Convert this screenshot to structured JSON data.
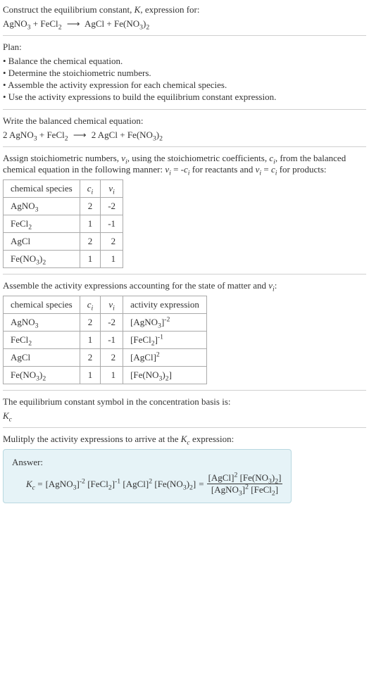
{
  "prompt": {
    "line1": "Construct the equilibrium constant, K, expression for:",
    "eq_lhs_1": "AgNO",
    "eq_lhs_1_sub": "3",
    "eq_plus1": " + ",
    "eq_lhs_2": "FeCl",
    "eq_lhs_2_sub": "2",
    "eq_arrow": "⟶",
    "eq_rhs_1": "AgCl",
    "eq_plus2": " + ",
    "eq_rhs_2": "Fe(NO",
    "eq_rhs_2_sub1": "3",
    "eq_rhs_2_mid": ")",
    "eq_rhs_2_sub2": "2"
  },
  "plan": {
    "title": "Plan:",
    "items": [
      "• Balance the chemical equation.",
      "• Determine the stoichiometric numbers.",
      "• Assemble the activity expression for each chemical species.",
      "• Use the activity expressions to build the equilibrium constant expression."
    ]
  },
  "balanced": {
    "title": "Write the balanced chemical equation:",
    "c1": "2 ",
    "s1": "AgNO",
    "s1sub": "3",
    "plus1": " + ",
    "s2": "FeCl",
    "s2sub": "2",
    "arrow": "⟶",
    "c3": "2 ",
    "s3": "AgCl",
    "plus2": " + ",
    "s4": "Fe(NO",
    "s4sub1": "3",
    "s4mid": ")",
    "s4sub2": "2"
  },
  "assign": {
    "text1": "Assign stoichiometric numbers, ",
    "nu": "ν",
    "nu_sub": "i",
    "text2": ", using the stoichiometric coefficients, ",
    "c": "c",
    "c_sub": "i",
    "text3": ", from the balanced chemical equation in the following manner: ",
    "eq1_l": "ν",
    "eq1_ls": "i",
    "eq1_m": " = -",
    "eq1_r": "c",
    "eq1_rs": "i",
    "text4": " for reactants and ",
    "eq2_l": "ν",
    "eq2_ls": "i",
    "eq2_m": " = ",
    "eq2_r": "c",
    "eq2_rs": "i",
    "text5": " for products:"
  },
  "table1": {
    "h1": "chemical species",
    "h2_a": "c",
    "h2_b": "i",
    "h3_a": "ν",
    "h3_b": "i",
    "rows": [
      {
        "sp_a": "AgNO",
        "sp_b": "3",
        "sp_c": "",
        "sp_d": "",
        "c": "2",
        "nu": "-2"
      },
      {
        "sp_a": "FeCl",
        "sp_b": "2",
        "sp_c": "",
        "sp_d": "",
        "c": "1",
        "nu": "-1"
      },
      {
        "sp_a": "AgCl",
        "sp_b": "",
        "sp_c": "",
        "sp_d": "",
        "c": "2",
        "nu": "2"
      },
      {
        "sp_a": "Fe(NO",
        "sp_b": "3",
        "sp_c": ")",
        "sp_d": "2",
        "c": "1",
        "nu": "1"
      }
    ]
  },
  "assemble": {
    "text1": "Assemble the activity expressions accounting for the state of matter and ",
    "nu": "ν",
    "nu_sub": "i",
    "text2": ":"
  },
  "table2": {
    "h1": "chemical species",
    "h2_a": "c",
    "h2_b": "i",
    "h3_a": "ν",
    "h3_b": "i",
    "h4": "activity expression",
    "rows": [
      {
        "sp_a": "AgNO",
        "sp_b": "3",
        "sp_c": "",
        "sp_d": "",
        "c": "2",
        "nu": "-2",
        "ae_a": "[AgNO",
        "ae_b": "3",
        "ae_c": "]",
        "ae_sup": "-2"
      },
      {
        "sp_a": "FeCl",
        "sp_b": "2",
        "sp_c": "",
        "sp_d": "",
        "c": "1",
        "nu": "-1",
        "ae_a": "[FeCl",
        "ae_b": "2",
        "ae_c": "]",
        "ae_sup": "-1"
      },
      {
        "sp_a": "AgCl",
        "sp_b": "",
        "sp_c": "",
        "sp_d": "",
        "c": "2",
        "nu": "2",
        "ae_a": "[AgCl]",
        "ae_b": "",
        "ae_c": "",
        "ae_sup": "2"
      },
      {
        "sp_a": "Fe(NO",
        "sp_b": "3",
        "sp_c": ")",
        "sp_d": "2",
        "c": "1",
        "nu": "1",
        "ae_a": "[Fe(NO",
        "ae_b": "3",
        "ae_c": ")",
        "ae_d": "2",
        "ae_e": "]",
        "ae_sup": ""
      }
    ]
  },
  "symbol": {
    "line1": "The equilibrium constant symbol in the concentration basis is:",
    "k": "K",
    "ksub": "c"
  },
  "multiply": {
    "text1": "Mulitply the activity expressions to arrive at the ",
    "k": "K",
    "ksub": "c",
    "text2": " expression:"
  },
  "answer": {
    "label": "Answer:",
    "k": "K",
    "ksub": "c",
    "eq": " = ",
    "t1a": "[AgNO",
    "t1b": "3",
    "t1c": "]",
    "t1sup": "-2",
    "t2a": "[FeCl",
    "t2b": "2",
    "t2c": "]",
    "t2sup": "-1",
    "t3a": "[AgCl]",
    "t3sup": "2",
    "t4a": "[Fe(NO",
    "t4b": "3",
    "t4c": ")",
    "t4d": "2",
    "t4e": "]",
    "eq2": " = ",
    "num_a": "[AgCl]",
    "num_asup": "2",
    "num_b1": "[Fe(NO",
    "num_b2": "3",
    "num_b3": ")",
    "num_b4": "2",
    "num_b5": "]",
    "den_a1": "[AgNO",
    "den_a2": "3",
    "den_a3": "]",
    "den_asup": "2",
    "den_b1": "[FeCl",
    "den_b2": "2",
    "den_b3": "]"
  }
}
